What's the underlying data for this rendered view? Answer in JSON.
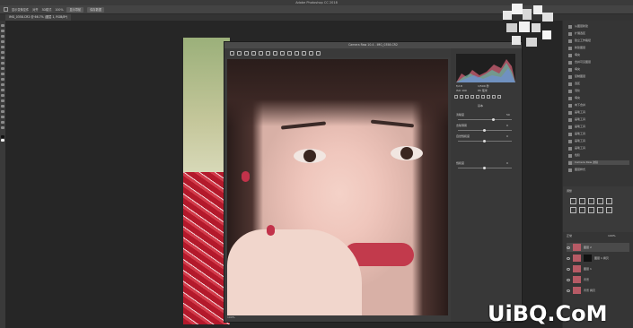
{
  "window": {
    "title": "Adobe Photoshop CC 2018"
  },
  "options_bar": {
    "items": [
      "显示变换控件",
      "对齐",
      "3D模式",
      "100%"
    ],
    "buttons": [
      "显示导航",
      "保存数据"
    ]
  },
  "document_tab": {
    "label": "IMG_0358.CR2 @ 66.7% (图层 1, RGB/8*)"
  },
  "camera_raw": {
    "title": "Camera Raw 10.4 - IMG_0358.CR2",
    "zoom": "100%",
    "panel_title": "基本",
    "sliders": [
      {
        "label": "清晰度",
        "value": "50"
      },
      {
        "label": "去除薄雾",
        "value": "0"
      },
      {
        "label": "自然饱和度",
        "value": "0"
      },
      {
        "label": "饱和度",
        "value": "0"
      }
    ],
    "histogram_readout": [
      "f/2.8",
      "1/500 秒",
      "ISO 100",
      "85 毫米"
    ]
  },
  "history_panel": {
    "items": [
      "从图层新建",
      "扩展选区",
      "建立工作路径",
      "新建图层",
      "填充",
      "合并可见图层",
      "填充",
      "复制图层",
      "选区",
      "羽化",
      "填充",
      "向下合并",
      "画笔工具",
      "画笔工具",
      "画笔工具",
      "画笔工具",
      "画笔工具",
      "画笔工具",
      "色阶",
      "Camera Raw 滤镜",
      "图层样式"
    ],
    "selected_index": 19
  },
  "adjustments_panel": {
    "title": "调整"
  },
  "layers_panel": {
    "blend_mode": "正常",
    "opacity": "100%",
    "layers": [
      {
        "name": "图层 2"
      },
      {
        "name": "图层 1 拷贝"
      },
      {
        "name": "图层 1"
      },
      {
        "name": "背景"
      },
      {
        "name": "背景 拷贝"
      }
    ]
  },
  "watermark": {
    "text": "UiBQ.CoM"
  }
}
